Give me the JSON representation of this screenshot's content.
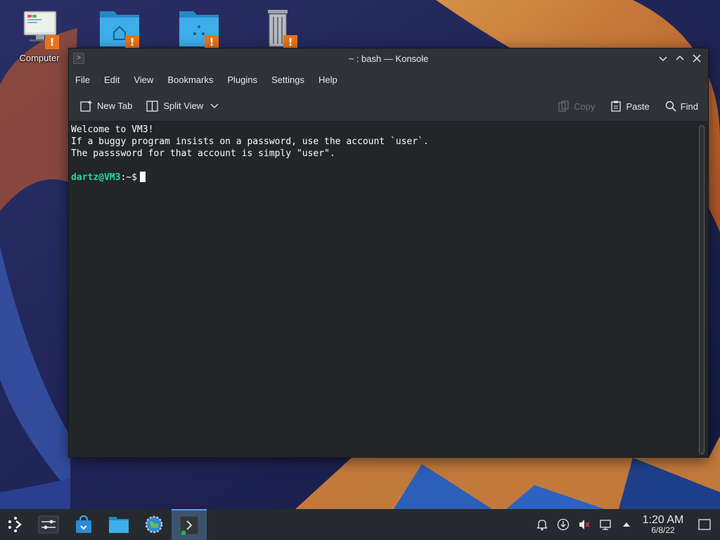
{
  "desktop": {
    "icons": [
      {
        "label": "Computer",
        "icon": "computer-icon"
      },
      {
        "label": "",
        "icon": "home-folder-icon"
      },
      {
        "label": "",
        "icon": "network-folder-icon"
      },
      {
        "label": "",
        "icon": "trash-icon"
      }
    ],
    "warning_glyph": "!"
  },
  "window": {
    "title": "~ : bash — Konsole",
    "menu": [
      "File",
      "Edit",
      "View",
      "Bookmarks",
      "Plugins",
      "Settings",
      "Help"
    ],
    "toolbar": {
      "new_tab": "New Tab",
      "split_view": "Split View",
      "copy": "Copy",
      "paste": "Paste",
      "find": "Find"
    },
    "terminal": {
      "lines": [
        "Welcome to VM3!",
        "If a buggy program insists on a password, use the account `user`.",
        "The passsword for that account is simply \"user\"."
      ],
      "prompt_user": "dartz@VM3",
      "prompt_path": ":~$"
    }
  },
  "taskbar": {
    "apps": [
      "application-launcher-icon",
      "settings-panel-icon",
      "discover-store-icon",
      "file-manager-icon",
      "web-browser-icon",
      "konsole-icon"
    ],
    "tray": [
      "notifications-icon",
      "updates-icon",
      "volume-muted-icon",
      "network-icon",
      "expand-tray-icon"
    ],
    "clock": {
      "time": "1:20 AM",
      "date": "6/8/22"
    }
  },
  "colors": {
    "accent": "#3daee9",
    "warning": "#e8741a",
    "prompt": "#1cdc9a",
    "terminal_bg": "#232629"
  }
}
